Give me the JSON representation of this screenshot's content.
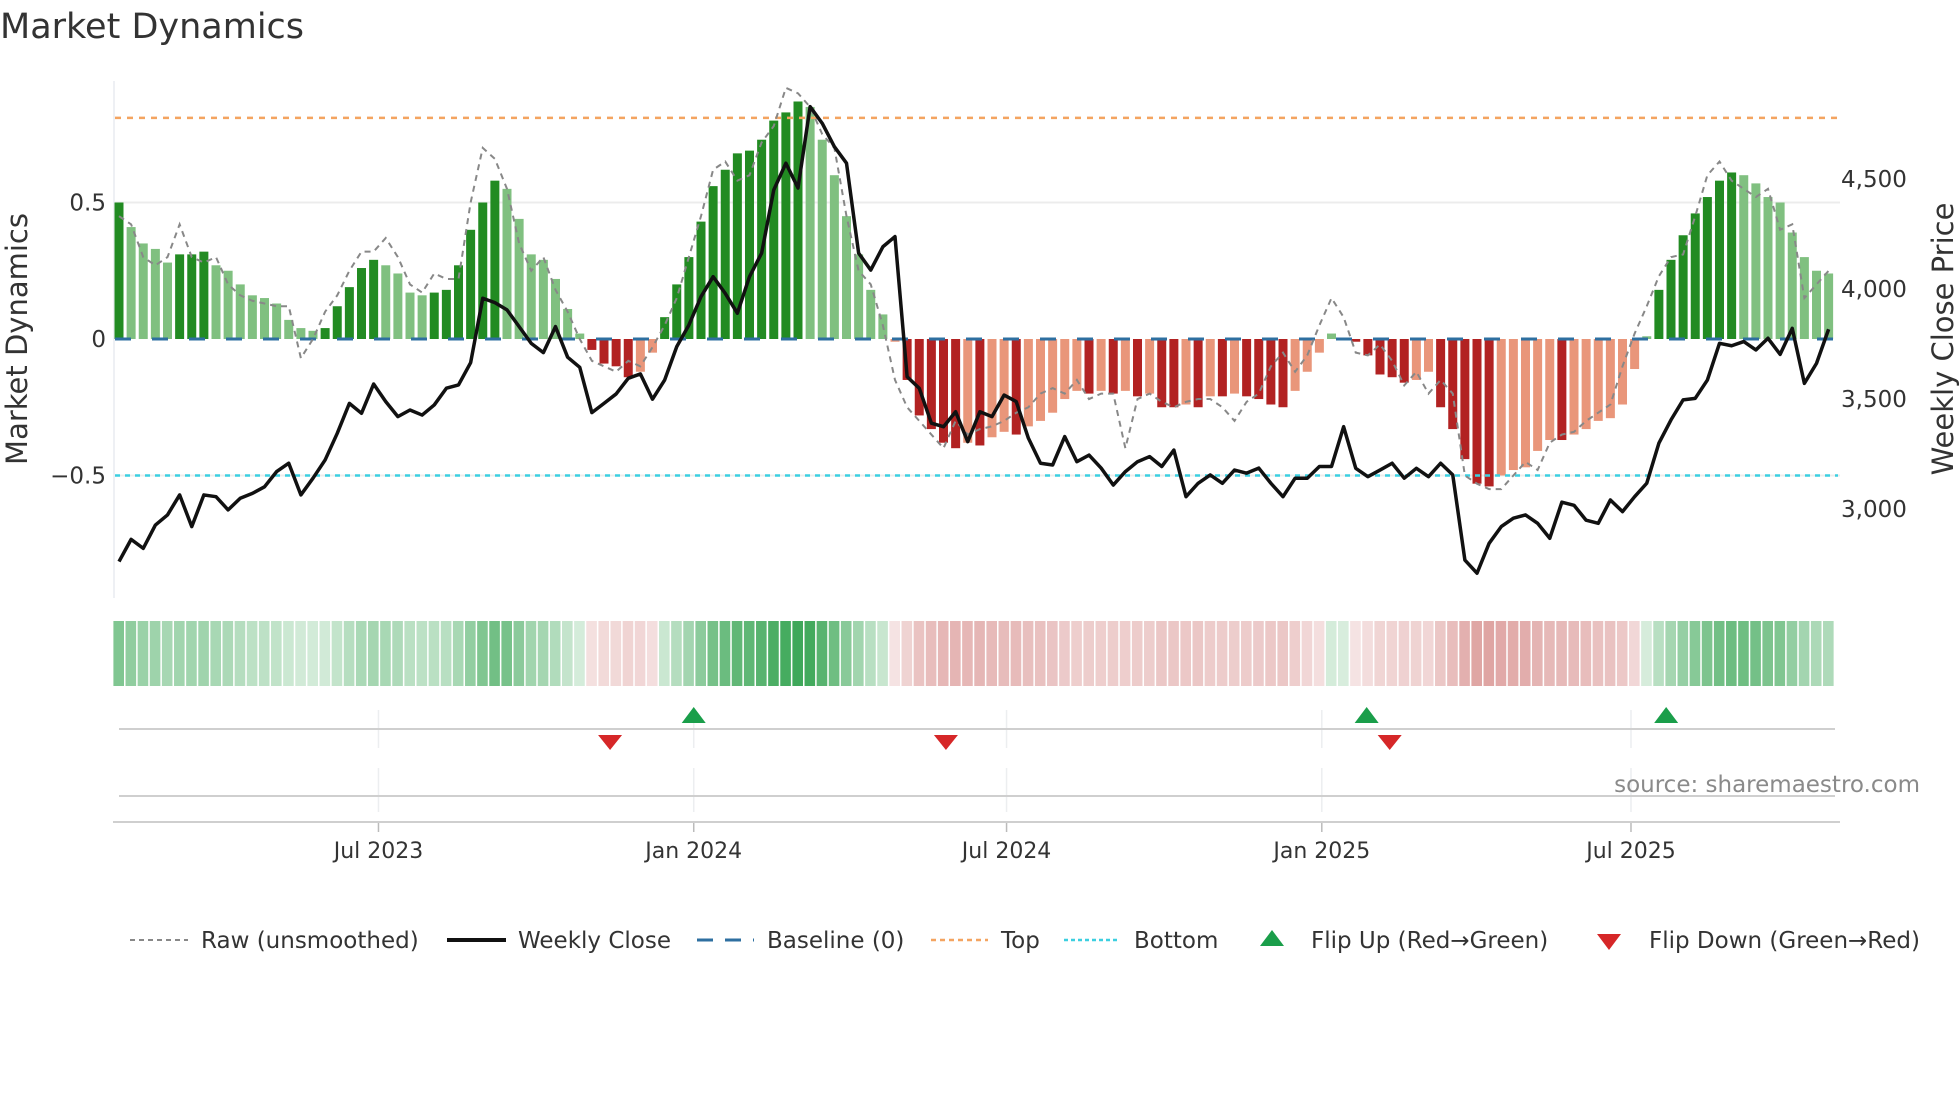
{
  "title": "Market Dynamics",
  "source": "source: sharemaestro.com",
  "colors": {
    "bar_green_strong": "#228b22",
    "bar_green_weak": "#80c080",
    "bar_red_strong": "#b22222",
    "bar_red_weak": "#e9967a",
    "raw": "#888888",
    "close": "#111111",
    "baseline": "#2e6fa0",
    "top": "#f4a460",
    "bottom": "#3ccfe0",
    "flip_up": "#1a9e4a",
    "flip_down": "#d62728",
    "heat_green": "#3aa655",
    "heat_red": "#d07a78"
  },
  "legend": {
    "raw": "Raw (unsmoothed)",
    "close": "Weekly Close",
    "baseline": "Baseline (0)",
    "top": "Top",
    "bottom": "Bottom",
    "flip_up": "Flip Up (Red→Green)",
    "flip_down": "Flip Down (Green→Red)"
  },
  "chart_data": {
    "type": "bar",
    "title": "Market Dynamics",
    "ylabel": "Market Dynamics",
    "ylabel_right": "Weekly Close Price",
    "ylim": [
      -0.95,
      0.945
    ],
    "ylim_right": [
      2596,
      4945
    ],
    "left_ticks": [
      {
        "value": 0.5,
        "label": "0.5"
      },
      {
        "value": 0,
        "label": "0"
      },
      {
        "value": -0.5,
        "label": "−0.5"
      }
    ],
    "right_ticks": [
      {
        "value": 4500,
        "label": "4,500"
      },
      {
        "value": 4000,
        "label": "4,000"
      },
      {
        "value": 3500,
        "label": "3,500"
      },
      {
        "value": 3000,
        "label": "3,000"
      }
    ],
    "x_ticks": [
      {
        "label": "Jul 2023",
        "week": 21.4
      },
      {
        "label": "Jan 2024",
        "week": 47.4
      },
      {
        "label": "Jul 2024",
        "week": 73.2
      },
      {
        "label": "Jan 2025",
        "week": 99.2
      },
      {
        "label": "Jul 2025",
        "week": 124.7
      }
    ],
    "top_level": 0.81,
    "bottom_level": -0.5,
    "baseline": 0,
    "dynamics": [
      0.5,
      0.41,
      0.35,
      0.33,
      0.28,
      0.31,
      0.31,
      0.32,
      0.27,
      0.25,
      0.2,
      0.16,
      0.15,
      0.13,
      0.07,
      0.04,
      0.03,
      0.04,
      0.12,
      0.19,
      0.26,
      0.29,
      0.27,
      0.24,
      0.17,
      0.16,
      0.17,
      0.18,
      0.27,
      0.4,
      0.5,
      0.58,
      0.55,
      0.44,
      0.31,
      0.29,
      0.22,
      0.11,
      0.02,
      -0.04,
      -0.09,
      -0.1,
      -0.14,
      -0.12,
      -0.05,
      0.08,
      0.2,
      0.3,
      0.43,
      0.56,
      0.62,
      0.68,
      0.69,
      0.73,
      0.8,
      0.83,
      0.87,
      0.85,
      0.73,
      0.6,
      0.45,
      0.31,
      0.18,
      0.09,
      -0.01,
      -0.15,
      -0.28,
      -0.33,
      -0.38,
      -0.4,
      -0.38,
      -0.39,
      -0.36,
      -0.34,
      -0.35,
      -0.32,
      -0.3,
      -0.27,
      -0.22,
      -0.19,
      -0.2,
      -0.19,
      -0.2,
      -0.19,
      -0.21,
      -0.2,
      -0.25,
      -0.25,
      -0.24,
      -0.25,
      -0.21,
      -0.21,
      -0.2,
      -0.21,
      -0.22,
      -0.24,
      -0.25,
      -0.19,
      -0.12,
      -0.05,
      0.02,
      0.0,
      -0.01,
      -0.06,
      -0.13,
      -0.14,
      -0.16,
      -0.15,
      -0.12,
      -0.25,
      -0.33,
      -0.44,
      -0.53,
      -0.54,
      -0.5,
      -0.48,
      -0.47,
      -0.41,
      -0.37,
      -0.37,
      -0.35,
      -0.33,
      -0.3,
      -0.29,
      -0.24,
      -0.11,
      0.01,
      0.18,
      0.29,
      0.38,
      0.46,
      0.52,
      0.58,
      0.61,
      0.6,
      0.57,
      0.52,
      0.5,
      0.39,
      0.3,
      0.25,
      0.24
    ],
    "raw": [
      0.45,
      0.42,
      0.3,
      0.27,
      0.3,
      0.42,
      0.3,
      0.28,
      0.3,
      0.2,
      0.16,
      0.14,
      0.13,
      0.12,
      0.12,
      -0.07,
      0.0,
      0.1,
      0.16,
      0.25,
      0.32,
      0.32,
      0.37,
      0.3,
      0.2,
      0.17,
      0.24,
      0.22,
      0.22,
      0.5,
      0.7,
      0.66,
      0.55,
      0.35,
      0.25,
      0.3,
      0.18,
      0.1,
      0.0,
      -0.08,
      -0.1,
      -0.12,
      -0.08,
      -0.1,
      -0.03,
      0.05,
      0.15,
      0.3,
      0.45,
      0.62,
      0.65,
      0.58,
      0.6,
      0.72,
      0.78,
      0.92,
      0.9,
      0.85,
      0.75,
      0.7,
      0.45,
      0.25,
      0.2,
      0.05,
      -0.15,
      -0.25,
      -0.3,
      -0.35,
      -0.4,
      -0.3,
      -0.35,
      -0.33,
      -0.32,
      -0.3,
      -0.27,
      -0.25,
      -0.2,
      -0.18,
      -0.2,
      -0.15,
      -0.22,
      -0.2,
      -0.2,
      -0.4,
      -0.22,
      -0.2,
      -0.23,
      -0.25,
      -0.23,
      -0.22,
      -0.22,
      -0.25,
      -0.3,
      -0.23,
      -0.2,
      -0.1,
      -0.05,
      -0.12,
      -0.06,
      0.05,
      0.15,
      0.08,
      -0.05,
      -0.06,
      -0.02,
      -0.08,
      -0.17,
      -0.12,
      -0.2,
      -0.15,
      -0.2,
      -0.5,
      -0.53,
      -0.55,
      -0.55,
      -0.5,
      -0.45,
      -0.48,
      -0.38,
      -0.35,
      -0.34,
      -0.3,
      -0.27,
      -0.24,
      -0.1,
      0.02,
      0.12,
      0.23,
      0.3,
      0.31,
      0.45,
      0.6,
      0.65,
      0.58,
      0.55,
      0.52,
      0.55,
      0.4,
      0.42,
      0.15,
      0.2,
      0.25
    ],
    "close": [
      2761,
      2862,
      2821,
      2927,
      2973,
      3064,
      2920,
      3064,
      3056,
      2996,
      3049,
      3071,
      3101,
      3170,
      3208,
      3064,
      3140,
      3223,
      3344,
      3480,
      3435,
      3568,
      3488,
      3420,
      3450,
      3427,
      3473,
      3549,
      3564,
      3665,
      3958,
      3938,
      3905,
      3829,
      3753,
      3711,
      3829,
      3690,
      3644,
      3438,
      3480,
      3523,
      3594,
      3614,
      3499,
      3586,
      3738,
      3836,
      3965,
      4056,
      3980,
      3890,
      4056,
      4163,
      4450,
      4572,
      4459,
      4829,
      4753,
      4647,
      4572,
      4163,
      4086,
      4192,
      4238,
      3601,
      3549,
      3390,
      3374,
      3442,
      3306,
      3442,
      3420,
      3518,
      3488,
      3322,
      3208,
      3200,
      3329,
      3215,
      3245,
      3186,
      3109,
      3170,
      3215,
      3238,
      3193,
      3268,
      3056,
      3117,
      3155,
      3117,
      3177,
      3163,
      3186,
      3117,
      3056,
      3140,
      3140,
      3193,
      3193,
      3374,
      3185,
      3147,
      3177,
      3208,
      3140,
      3185,
      3147,
      3208,
      3155,
      2768,
      2708,
      2844,
      2920,
      2958,
      2973,
      2935,
      2867,
      3031,
      3017,
      2949,
      2935,
      3041,
      2988,
      3056,
      3117,
      3299,
      3405,
      3496,
      3503,
      3586,
      3753,
      3742,
      3761,
      3723,
      3776,
      3703,
      3821,
      3571,
      3662,
      3817
    ],
    "flips_up": [
      47.4,
      102.9,
      127.6
    ],
    "flips_down": [
      40.5,
      68.2,
      104.8
    ]
  }
}
